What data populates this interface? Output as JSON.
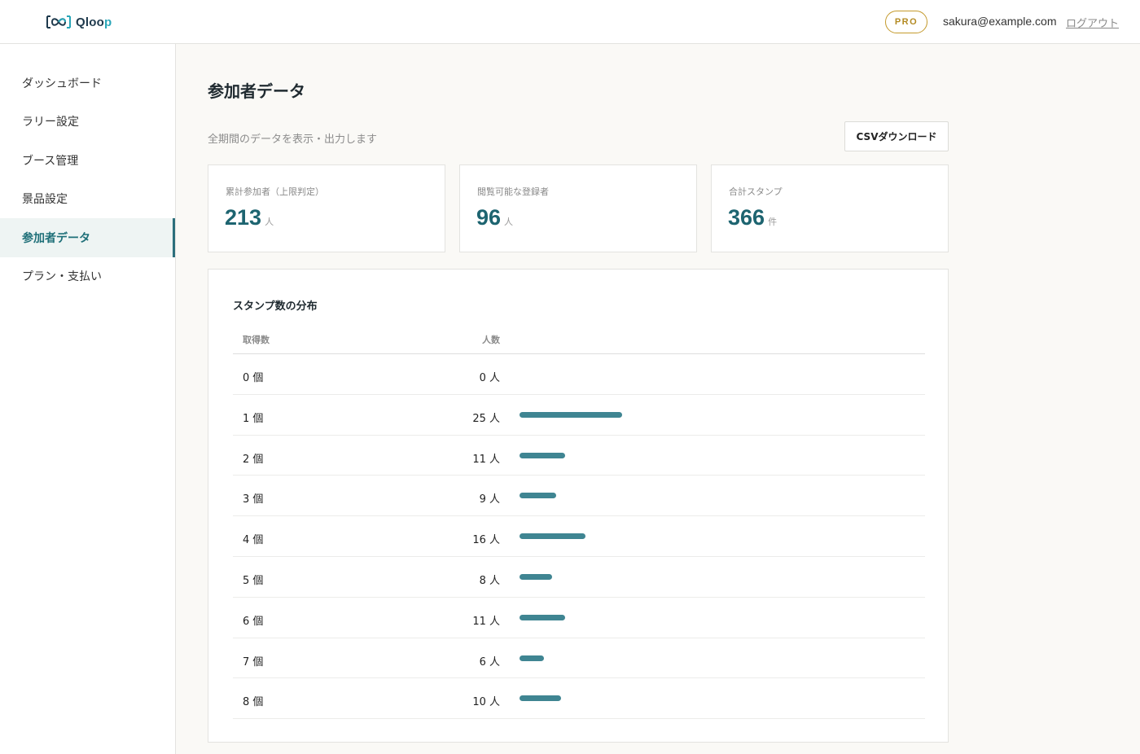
{
  "header": {
    "logo_prefix": "Qloo",
    "logo_accent": "p",
    "plan_badge": "PRO",
    "user_email": "sakura@example.com",
    "logout_label": "ログアウト"
  },
  "sidebar": {
    "items": [
      {
        "label": "ダッシュボード",
        "active": false
      },
      {
        "label": "ラリー設定",
        "active": false
      },
      {
        "label": "ブース管理",
        "active": false
      },
      {
        "label": "景品設定",
        "active": false
      },
      {
        "label": "参加者データ",
        "active": true
      },
      {
        "label": "プラン・支払い",
        "active": false
      }
    ]
  },
  "main": {
    "title": "参加者データ",
    "subtitle": "全期間のデータを表示・出力します",
    "csv_button_label": "CSVダウンロード",
    "stats": [
      {
        "label": "累計参加者（上限判定）",
        "value": "213",
        "unit": "人"
      },
      {
        "label": "閲覧可能な登録者",
        "value": "96",
        "unit": "人"
      },
      {
        "label": "合計スタンプ",
        "value": "366",
        "unit": "件"
      }
    ],
    "distribution": {
      "title": "スタンプ数の分布",
      "col_count": "取得数",
      "col_people": "人数",
      "rows": [
        {
          "count": "0 個",
          "people": "0 人",
          "value": 0
        },
        {
          "count": "1 個",
          "people": "25 人",
          "value": 25
        },
        {
          "count": "2 個",
          "people": "11 人",
          "value": 11
        },
        {
          "count": "3 個",
          "people": "9 人",
          "value": 9
        },
        {
          "count": "4 個",
          "people": "16 人",
          "value": 16
        },
        {
          "count": "5 個",
          "people": "8 人",
          "value": 8
        },
        {
          "count": "6 個",
          "people": "11 人",
          "value": 11
        },
        {
          "count": "7 個",
          "people": "6 人",
          "value": 6
        },
        {
          "count": "8 個",
          "people": "10 人",
          "value": 10
        }
      ]
    }
  },
  "colors": {
    "accent": "#1d6470",
    "bar": "#3f8592",
    "pro_badge": "#c49a2c"
  }
}
